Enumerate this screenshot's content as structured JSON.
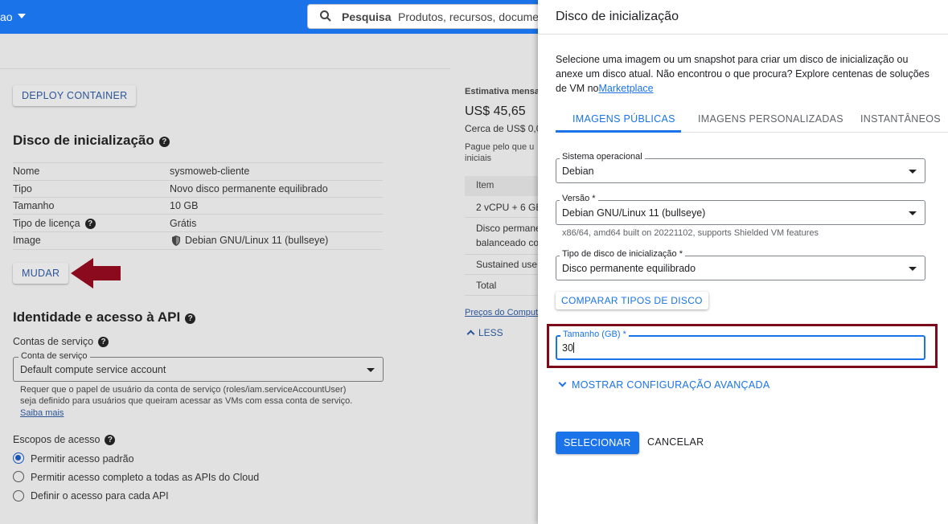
{
  "topbar": {
    "project_fragment": "ao",
    "search_label": "Pesquisa",
    "search_placeholder": "Produtos, recursos, docume"
  },
  "background": {
    "deploy_container_button": "DEPLOY CONTAINER",
    "boot_disk_section": {
      "title": "Disco de inicialização",
      "rows": [
        {
          "label": "Nome",
          "value": "sysmoweb-cliente"
        },
        {
          "label": "Tipo",
          "value": "Novo disco permanente equilibrado"
        },
        {
          "label": "Tamanho",
          "value": "10 GB"
        },
        {
          "label": "Tipo de licença",
          "value": "Grátis"
        },
        {
          "label": "Image",
          "value": "Debian GNU/Linux 11 (bullseye)"
        }
      ],
      "change_button": "MUDAR"
    },
    "identity_section": {
      "title": "Identidade e acesso à API",
      "service_accounts_label": "Contas de serviço",
      "service_account_field_label": "Conta de serviço",
      "service_account_value": "Default compute service account",
      "help_text_1": "Requer que o papel de usuário da conta de serviço (roles/iam.serviceAccountUser)",
      "help_text_2": "seja definido para usuários que queiram acessar as VMs com essa conta de serviço.",
      "learn_more": "Saiba mais",
      "access_scopes_label": "Escopos de acesso",
      "access_options": [
        {
          "label": "Permitir acesso padrão",
          "selected": true
        },
        {
          "label": "Permitir acesso completo a todas as APIs do Cloud",
          "selected": false
        },
        {
          "label": "Definir o acesso para cada API",
          "selected": false
        }
      ]
    },
    "estimate": {
      "label": "Estimativa mensa",
      "price": "US$ 45,65",
      "hourly": "Cerca de US$ 0,0",
      "note_1": "Pague pelo que u",
      "note_2": "iniciais",
      "table_header": "Item",
      "rows": [
        "2 vCPU + 6 GB",
        "Disco permane",
        "balanceado co",
        "Sustained use",
        "Total"
      ],
      "pricing_link": "Preços do Comput",
      "less_link": "LESS"
    }
  },
  "panel": {
    "title": "Disco de inicialização",
    "description": "Selecione uma imagem ou um snapshot para criar um disco de inicialização ou anexe um disco atual. Não encontrou o que procura? Explore centenas de soluções de VM no",
    "marketplace_link": "Marketplace",
    "tabs": [
      "IMAGENS PÚBLICAS",
      "IMAGENS PERSONALIZADAS",
      "INSTANTÂNEOS"
    ],
    "os_label": "Sistema operacional",
    "os_value": "Debian",
    "version_label": "Versão *",
    "version_value": "Debian GNU/Linux 11 (bullseye)",
    "version_hint": "x86/64, amd64 built on 20221102, supports Shielded VM features",
    "disk_type_label": "Tipo de disco de inicialização *",
    "disk_type_value": "Disco permanente equilibrado",
    "compare_button": "COMPARAR TIPOS DE DISCO",
    "size_label": "Tamanho (GB) *",
    "size_value": "30",
    "advanced_toggle": "MOSTRAR CONFIGURAÇÃO AVANÇADA",
    "select_button": "SELECIONAR",
    "cancel_button": "CANCELAR"
  },
  "colors": {
    "accent": "#1a73e8",
    "highlight_box": "#7b0a1b",
    "arrow": "#8b0a1e"
  }
}
